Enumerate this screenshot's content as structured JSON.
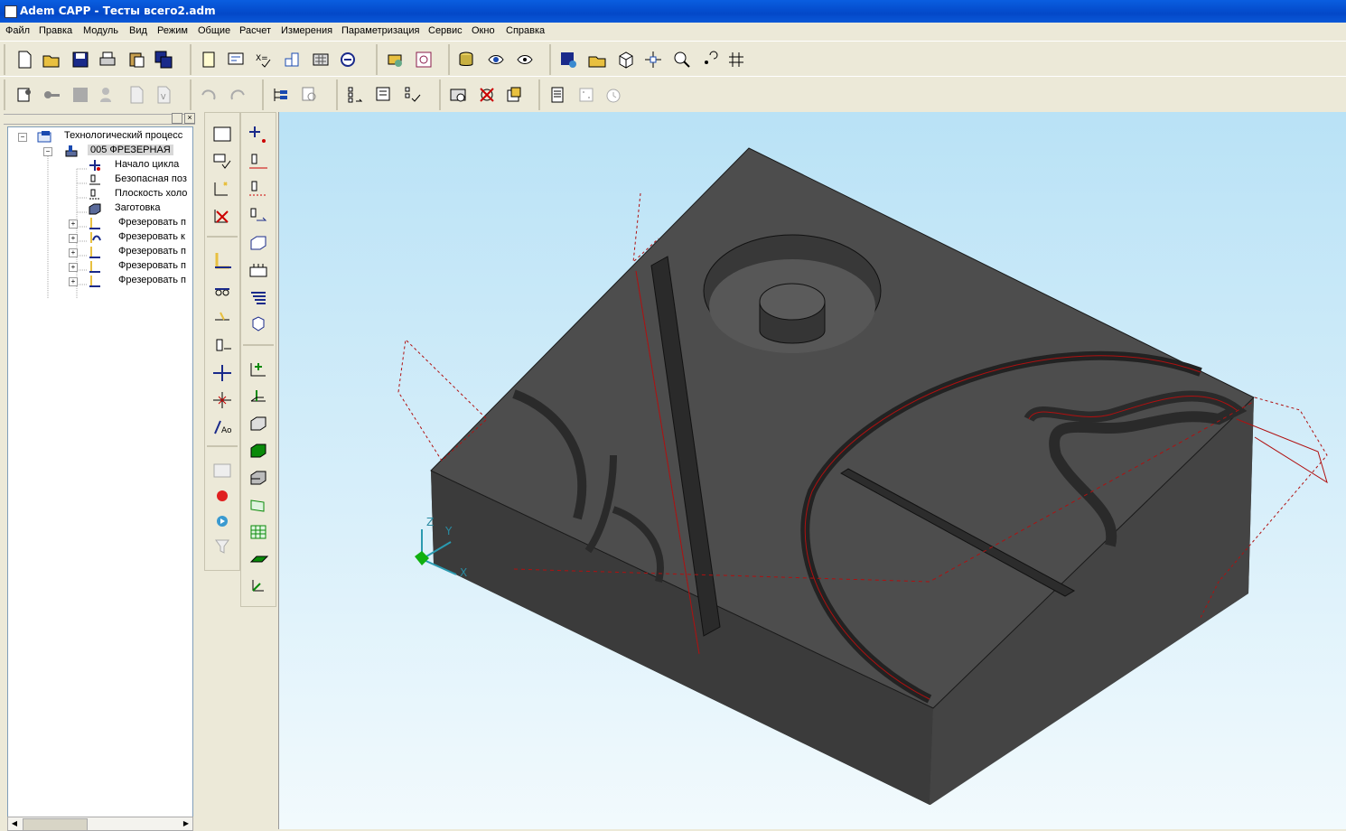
{
  "window": {
    "title": "Adem CAPP - Тесты всего2.adm"
  },
  "menu": [
    "Файл",
    "Правка",
    "Модуль",
    "Вид",
    "Режим",
    "Общие",
    "Расчет",
    "Измерения",
    "Параметризация",
    "Сервис",
    "Окно",
    "Справка"
  ],
  "tree": {
    "root": "Технологический процесс",
    "operation": "005 ФРЕЗЕРНАЯ",
    "items": [
      "Начало цикла",
      "Безопасная поз",
      "Плоскость холо",
      "Заготовка"
    ],
    "milling": [
      "Фрезеровать п",
      "Фрезеровать к",
      "Фрезеровать п",
      "Фрезеровать п",
      "Фрезеровать п"
    ]
  },
  "axes": {
    "x": "X",
    "y": "Y",
    "z": "Z"
  },
  "colors": {
    "titlebar": "#0a5ee0",
    "toolpath": "#b01010",
    "model": "#3f3f3f"
  }
}
